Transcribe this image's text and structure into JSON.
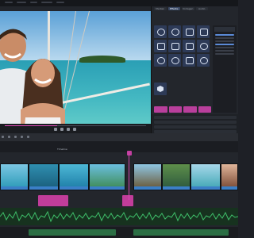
{
  "app": {
    "accent": "#d24ab0",
    "timeline_clip_bar": "#3b7fc7"
  },
  "right_panel": {
    "tabs": [
      {
        "label": "Medien",
        "active": false
      },
      {
        "label": "Effekte",
        "active": true
      },
      {
        "label": "Vorlagen",
        "active": false
      },
      {
        "label": "Audio",
        "active": false
      }
    ],
    "effect_icons": [
      "wave-effect-icon",
      "circle-effect-icon",
      "frame-effect-icon",
      "grid-effect-icon",
      "picture-effect-icon",
      "image-effect-icon",
      "crop-effect-icon",
      "sparkle-effect-icon",
      "sun-effect-icon",
      "spiral-effect-icon",
      "text-effect-icon",
      "color-effect-icon",
      "mask-effect-icon",
      "blur-effect-icon",
      "drop-effect-icon",
      "star-effect-icon"
    ]
  },
  "timeline": {
    "time_label": "Timeline"
  }
}
